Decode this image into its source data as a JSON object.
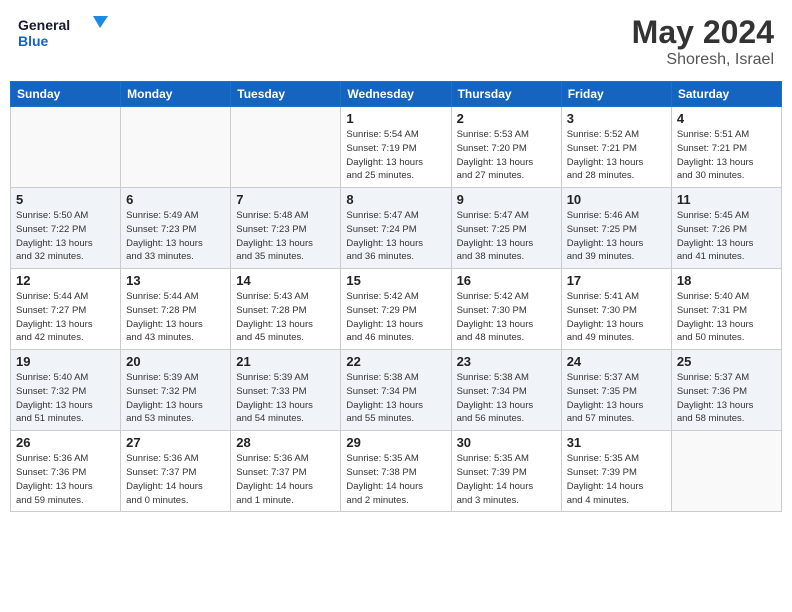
{
  "header": {
    "logo_line1": "General",
    "logo_line2": "Blue",
    "month": "May 2024",
    "location": "Shoresh, Israel"
  },
  "days_of_week": [
    "Sunday",
    "Monday",
    "Tuesday",
    "Wednesday",
    "Thursday",
    "Friday",
    "Saturday"
  ],
  "weeks": [
    [
      {
        "num": "",
        "info": "",
        "empty": true
      },
      {
        "num": "",
        "info": "",
        "empty": true
      },
      {
        "num": "",
        "info": "",
        "empty": true
      },
      {
        "num": "1",
        "info": "Sunrise: 5:54 AM\nSunset: 7:19 PM\nDaylight: 13 hours\nand 25 minutes."
      },
      {
        "num": "2",
        "info": "Sunrise: 5:53 AM\nSunset: 7:20 PM\nDaylight: 13 hours\nand 27 minutes."
      },
      {
        "num": "3",
        "info": "Sunrise: 5:52 AM\nSunset: 7:21 PM\nDaylight: 13 hours\nand 28 minutes."
      },
      {
        "num": "4",
        "info": "Sunrise: 5:51 AM\nSunset: 7:21 PM\nDaylight: 13 hours\nand 30 minutes."
      }
    ],
    [
      {
        "num": "5",
        "info": "Sunrise: 5:50 AM\nSunset: 7:22 PM\nDaylight: 13 hours\nand 32 minutes."
      },
      {
        "num": "6",
        "info": "Sunrise: 5:49 AM\nSunset: 7:23 PM\nDaylight: 13 hours\nand 33 minutes."
      },
      {
        "num": "7",
        "info": "Sunrise: 5:48 AM\nSunset: 7:23 PM\nDaylight: 13 hours\nand 35 minutes."
      },
      {
        "num": "8",
        "info": "Sunrise: 5:47 AM\nSunset: 7:24 PM\nDaylight: 13 hours\nand 36 minutes."
      },
      {
        "num": "9",
        "info": "Sunrise: 5:47 AM\nSunset: 7:25 PM\nDaylight: 13 hours\nand 38 minutes."
      },
      {
        "num": "10",
        "info": "Sunrise: 5:46 AM\nSunset: 7:25 PM\nDaylight: 13 hours\nand 39 minutes."
      },
      {
        "num": "11",
        "info": "Sunrise: 5:45 AM\nSunset: 7:26 PM\nDaylight: 13 hours\nand 41 minutes."
      }
    ],
    [
      {
        "num": "12",
        "info": "Sunrise: 5:44 AM\nSunset: 7:27 PM\nDaylight: 13 hours\nand 42 minutes."
      },
      {
        "num": "13",
        "info": "Sunrise: 5:44 AM\nSunset: 7:28 PM\nDaylight: 13 hours\nand 43 minutes."
      },
      {
        "num": "14",
        "info": "Sunrise: 5:43 AM\nSunset: 7:28 PM\nDaylight: 13 hours\nand 45 minutes."
      },
      {
        "num": "15",
        "info": "Sunrise: 5:42 AM\nSunset: 7:29 PM\nDaylight: 13 hours\nand 46 minutes."
      },
      {
        "num": "16",
        "info": "Sunrise: 5:42 AM\nSunset: 7:30 PM\nDaylight: 13 hours\nand 48 minutes."
      },
      {
        "num": "17",
        "info": "Sunrise: 5:41 AM\nSunset: 7:30 PM\nDaylight: 13 hours\nand 49 minutes."
      },
      {
        "num": "18",
        "info": "Sunrise: 5:40 AM\nSunset: 7:31 PM\nDaylight: 13 hours\nand 50 minutes."
      }
    ],
    [
      {
        "num": "19",
        "info": "Sunrise: 5:40 AM\nSunset: 7:32 PM\nDaylight: 13 hours\nand 51 minutes."
      },
      {
        "num": "20",
        "info": "Sunrise: 5:39 AM\nSunset: 7:32 PM\nDaylight: 13 hours\nand 53 minutes."
      },
      {
        "num": "21",
        "info": "Sunrise: 5:39 AM\nSunset: 7:33 PM\nDaylight: 13 hours\nand 54 minutes."
      },
      {
        "num": "22",
        "info": "Sunrise: 5:38 AM\nSunset: 7:34 PM\nDaylight: 13 hours\nand 55 minutes."
      },
      {
        "num": "23",
        "info": "Sunrise: 5:38 AM\nSunset: 7:34 PM\nDaylight: 13 hours\nand 56 minutes."
      },
      {
        "num": "24",
        "info": "Sunrise: 5:37 AM\nSunset: 7:35 PM\nDaylight: 13 hours\nand 57 minutes."
      },
      {
        "num": "25",
        "info": "Sunrise: 5:37 AM\nSunset: 7:36 PM\nDaylight: 13 hours\nand 58 minutes."
      }
    ],
    [
      {
        "num": "26",
        "info": "Sunrise: 5:36 AM\nSunset: 7:36 PM\nDaylight: 13 hours\nand 59 minutes."
      },
      {
        "num": "27",
        "info": "Sunrise: 5:36 AM\nSunset: 7:37 PM\nDaylight: 14 hours\nand 0 minutes."
      },
      {
        "num": "28",
        "info": "Sunrise: 5:36 AM\nSunset: 7:37 PM\nDaylight: 14 hours\nand 1 minute."
      },
      {
        "num": "29",
        "info": "Sunrise: 5:35 AM\nSunset: 7:38 PM\nDaylight: 14 hours\nand 2 minutes."
      },
      {
        "num": "30",
        "info": "Sunrise: 5:35 AM\nSunset: 7:39 PM\nDaylight: 14 hours\nand 3 minutes."
      },
      {
        "num": "31",
        "info": "Sunrise: 5:35 AM\nSunset: 7:39 PM\nDaylight: 14 hours\nand 4 minutes."
      },
      {
        "num": "",
        "info": "",
        "empty": true
      }
    ]
  ]
}
